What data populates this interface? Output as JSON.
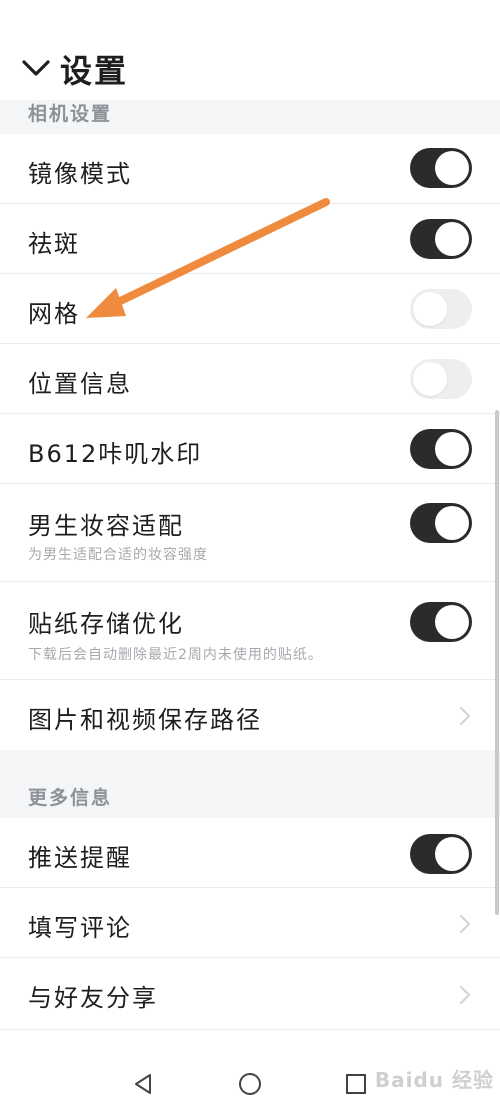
{
  "header": {
    "title": "设置"
  },
  "sections": {
    "camera": {
      "title": "相机设置"
    },
    "more": {
      "title": "更多信息"
    }
  },
  "rows": {
    "mirror": {
      "label": "镜像模式",
      "toggle": "on"
    },
    "blemish": {
      "label": "祛斑",
      "toggle": "on"
    },
    "grid": {
      "label": "网格",
      "toggle": "off"
    },
    "location": {
      "label": "位置信息",
      "toggle": "off"
    },
    "watermark": {
      "label": "B612咔叽水印",
      "toggle": "on"
    },
    "male_makeup": {
      "label": "男生妆容适配",
      "sub": "为男生适配合适的妆容强度",
      "toggle": "on"
    },
    "sticker_storage": {
      "label": "贴纸存储优化",
      "sub": "下载后会自动删除最近2周内未使用的贴纸。",
      "toggle": "on"
    },
    "save_path": {
      "label": "图片和视频保存路径"
    },
    "push": {
      "label": "推送提醒",
      "toggle": "on"
    },
    "review": {
      "label": "填写评论"
    },
    "share": {
      "label": "与好友分享"
    }
  },
  "watermark_logo": {
    "text": "Baidu 经验"
  },
  "colors": {
    "toggle_on": "#2b2b2b",
    "toggle_off": "#eeeeee",
    "annotation_arrow": "#f08a3e",
    "section_bg": "#f4f5f7"
  }
}
